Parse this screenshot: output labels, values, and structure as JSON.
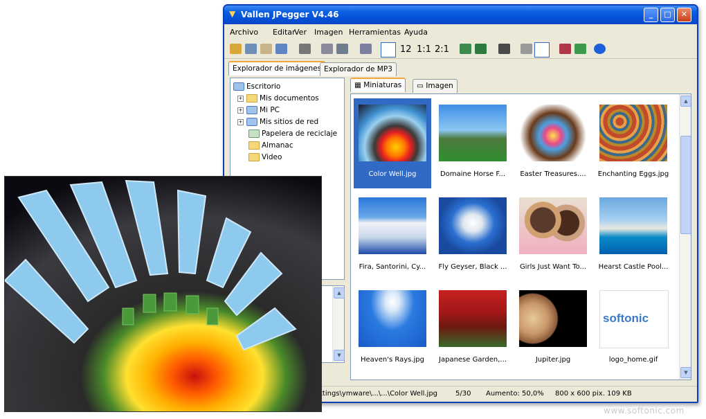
{
  "window": {
    "title": "Vallen JPegger V4.46",
    "min": "_",
    "max": "□",
    "close": "✕"
  },
  "menu": [
    "Archivo",
    "Editar",
    "Ver",
    "Imagen",
    "Herramientas",
    "Ayuda"
  ],
  "toolbar": {
    "zoom1": "12",
    "zoom2": "1:1",
    "zoom3": "2:1"
  },
  "tabs": {
    "explorer_images": "Explorador de imágenes",
    "explorer_mp3": "Explorador de MP3"
  },
  "tree": {
    "root": "Escritorio",
    "items": [
      "Mis documentos",
      "Mi PC",
      "Mis sitios de red",
      "Papelera de reciclaje",
      "Almanac",
      "Video"
    ]
  },
  "viewtabs": {
    "thumbs": "Miniaturas",
    "image": "Imagen"
  },
  "thumbnails": [
    "Color Well.jpg",
    "Domaine Horse F...",
    "Easter Treasures....",
    "Enchanting Eggs.jpg",
    "Fira, Santorini, Cy...",
    "Fly Geyser, Black ...",
    "Girls Just Want To...",
    "Hearst Castle Pool...",
    "Heaven's Rays.jpg",
    "Japanese Garden,...",
    "Jupiter.jpg",
    "logo_home.gif"
  ],
  "softonic_logo": "softonic",
  "status": {
    "path": "ttings\\ymware\\...\\...\\Color Well.jpg",
    "count": "5/30",
    "zoom": "Aumento: 50,0%",
    "dims": "800 x 600 pix. 109 KB"
  },
  "watermark": "www.softonic.com"
}
